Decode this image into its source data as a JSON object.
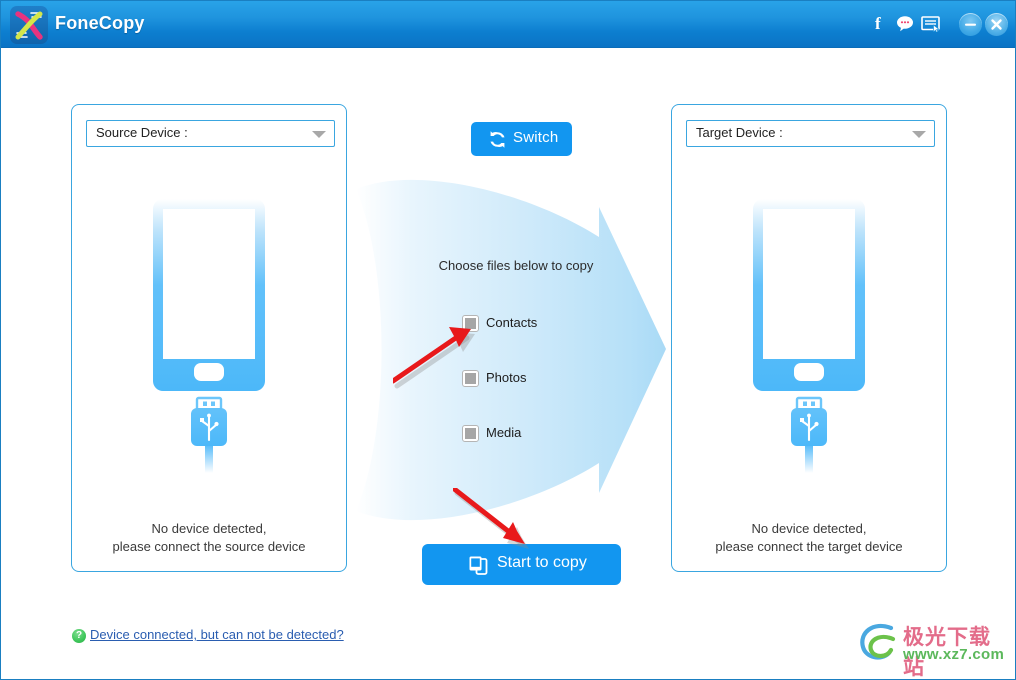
{
  "window": {
    "title": "FoneCopy",
    "logo_icon": "dna-helix-logo-icon",
    "titlebar_icons": [
      {
        "name": "facebook-icon",
        "glyph": "f"
      },
      {
        "name": "chat-bubble-icon",
        "glyph": "speech-bubble"
      },
      {
        "name": "feedback-form-icon",
        "glyph": "form-cursor"
      }
    ],
    "minimize_label": "–",
    "close_label": "×",
    "accent_color": "#1296f0",
    "titlebar_color": "#1f94de",
    "panel_border_color": "#3aa6e0"
  },
  "source_panel": {
    "select_label": "Source Device :",
    "select_value": "",
    "dropdown_icon": "chevron-down-icon",
    "device_icon": "smartphone-icon",
    "usb_icon": "usb-connector-icon",
    "status_line1": "No device detected,",
    "status_line2": "please connect the source device"
  },
  "target_panel": {
    "select_label": "Target Device :",
    "select_value": "",
    "dropdown_icon": "chevron-down-icon",
    "device_icon": "smartphone-icon",
    "usb_icon": "usb-connector-icon",
    "status_line1": "No device detected,",
    "status_line2": "please connect the target device"
  },
  "center": {
    "switch_label": "Switch",
    "switch_icon": "refresh-circular-arrows-icon",
    "choose_label": "Choose files below to copy",
    "file_types": [
      {
        "label": "Contacts",
        "checked": false
      },
      {
        "label": "Photos",
        "checked": false
      },
      {
        "label": "Media",
        "checked": false
      }
    ],
    "start_label": "Start to copy",
    "start_icon": "two-devices-copy-icon",
    "transfer_arrow_icon": "large-right-arrow-icon"
  },
  "footer": {
    "help_badge": "?",
    "help_link": "Device connected, but can not be detected?"
  },
  "watermark": {
    "cn_text": "极光下载站",
    "url_text": "www.xz7.com",
    "logo_icon": "swirl-logo-icon"
  },
  "annotations": [
    {
      "name": "red-arrow-to-contacts",
      "direction": "up-right",
      "color": "#e8191b"
    },
    {
      "name": "red-arrow-to-start-button",
      "direction": "down-right",
      "color": "#e8191b"
    }
  ]
}
